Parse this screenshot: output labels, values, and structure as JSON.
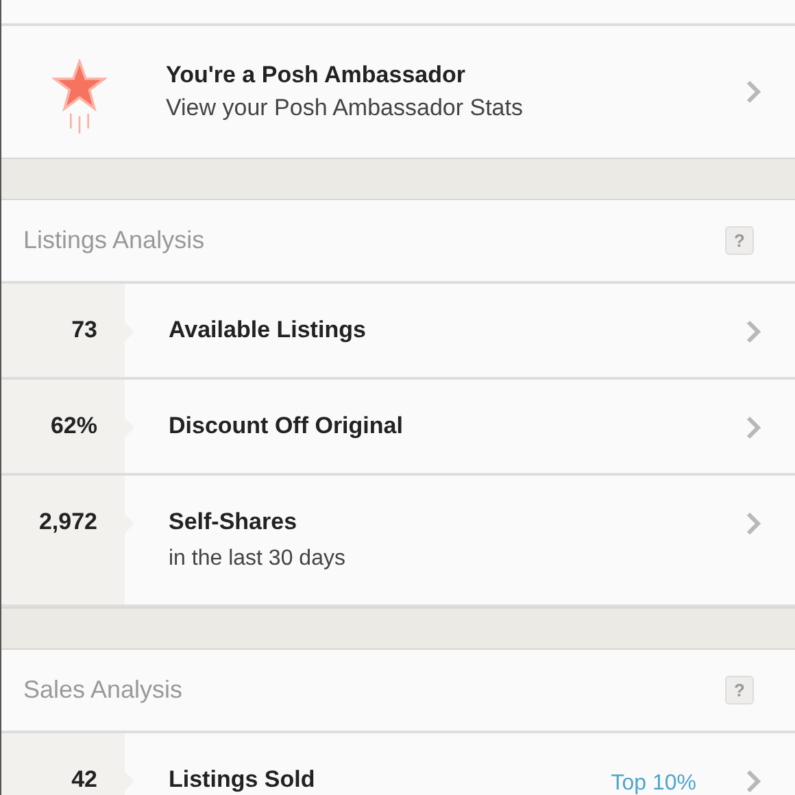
{
  "ambassador": {
    "title": "You're a Posh Ambassador",
    "subtitle": "View your Posh Ambassador Stats"
  },
  "sections": [
    {
      "title": "Listings Analysis",
      "help": "?",
      "rows": [
        {
          "value": "73",
          "label": "Available Listings"
        },
        {
          "value": "62%",
          "label": "Discount Off Original"
        },
        {
          "value": "2,972",
          "label": "Self-Shares",
          "sublabel": "in the last 30 days"
        }
      ]
    },
    {
      "title": "Sales Analysis",
      "help": "?",
      "rows": [
        {
          "value": "42",
          "label": "Listings Sold",
          "badge": "Top 10%"
        }
      ]
    }
  ]
}
